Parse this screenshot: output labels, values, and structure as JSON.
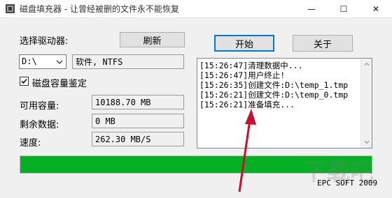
{
  "window": {
    "title": "磁盘填充器 - 让曾经被删的文件永不能恢复",
    "minimize": "—",
    "maximize": "☐",
    "close": "✕"
  },
  "drive": {
    "select_label": "选择驱动器:",
    "refresh_button": "刷新",
    "selected": "D:\\",
    "info": "软件, NTFS",
    "capacity_check_label": "磁盘容量鉴定",
    "capacity_check_checked": true
  },
  "stats": {
    "available_label": "可用容量:",
    "available_value": "10188.70 MB",
    "remaining_label": "剩余数据:",
    "remaining_value": "0 MB",
    "speed_label": "速度:",
    "speed_value": "262.30 MB/S"
  },
  "actions": {
    "start_button": "开始",
    "about_button": "关于"
  },
  "log": {
    "lines": [
      "[15:26:47]清理数据中...",
      "[15:26:47]用户终止!",
      "[15:26:35]创建文件:D:\\temp_1.tmp",
      "[15:26:21]创建文件:D:\\temp_0.tmp",
      "[15:26:21]准备填充..."
    ]
  },
  "progress": {
    "percent": 100,
    "color": "#06b025"
  },
  "footer": {
    "copyright": "EPC SOFT 2009"
  },
  "annotation": {
    "arrow_color": "#c8102e"
  }
}
